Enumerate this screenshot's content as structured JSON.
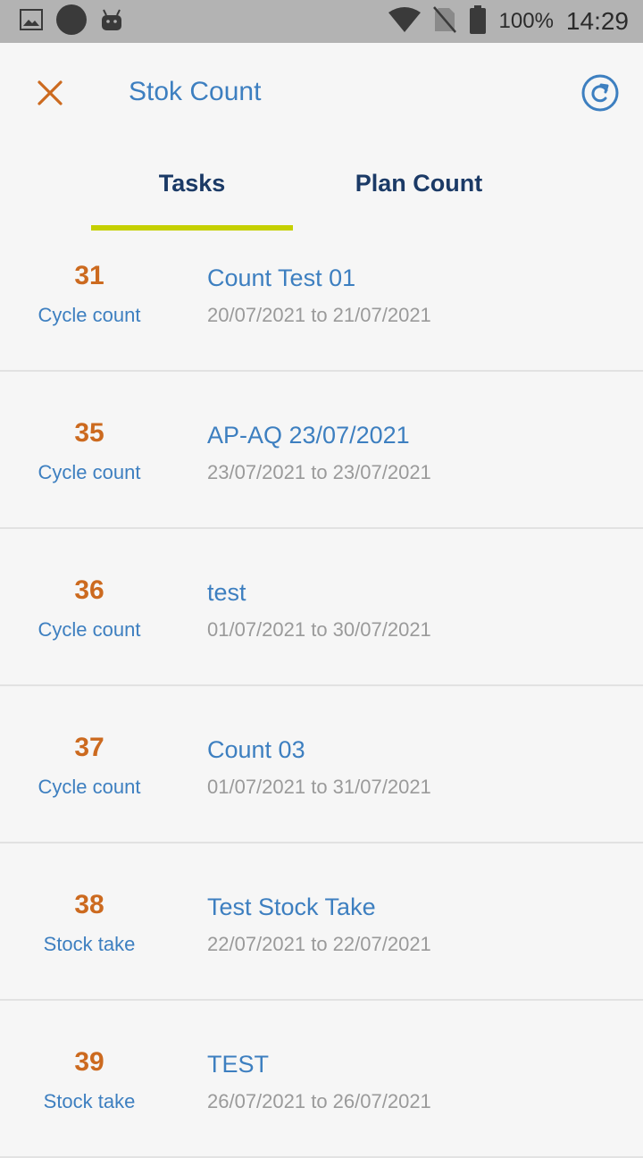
{
  "status_bar": {
    "icons": [
      "image-icon",
      "circle-icon",
      "android-icon",
      "wifi-icon",
      "no-sim-icon",
      "battery-icon"
    ],
    "battery": "100%",
    "time": "14:29"
  },
  "app_bar": {
    "title": "Stok Count",
    "close_icon": "close-icon",
    "refresh_icon": "refresh-icon",
    "accent_color": "#cc6a1f",
    "primary_color": "#3d7fc0"
  },
  "tabs": {
    "items": [
      {
        "label": "Tasks",
        "selected": true
      },
      {
        "label": "Plan Count",
        "selected": false
      }
    ],
    "indicator_color": "#c5d000"
  },
  "tasks": [
    {
      "id": "31",
      "type": "Cycle count",
      "name": "Count Test 01",
      "dates": "20/07/2021 to 21/07/2021"
    },
    {
      "id": "35",
      "type": "Cycle count",
      "name": "AP-AQ 23/07/2021",
      "dates": "23/07/2021 to 23/07/2021"
    },
    {
      "id": "36",
      "type": "Cycle count",
      "name": "test",
      "dates": "01/07/2021 to 30/07/2021"
    },
    {
      "id": "37",
      "type": "Cycle count",
      "name": "Count 03",
      "dates": "01/07/2021 to 31/07/2021"
    },
    {
      "id": "38",
      "type": "Stock take",
      "name": "Test Stock Take",
      "dates": "22/07/2021 to 22/07/2021"
    },
    {
      "id": "39",
      "type": "Stock take",
      "name": "TEST",
      "dates": "26/07/2021 to 26/07/2021"
    }
  ]
}
